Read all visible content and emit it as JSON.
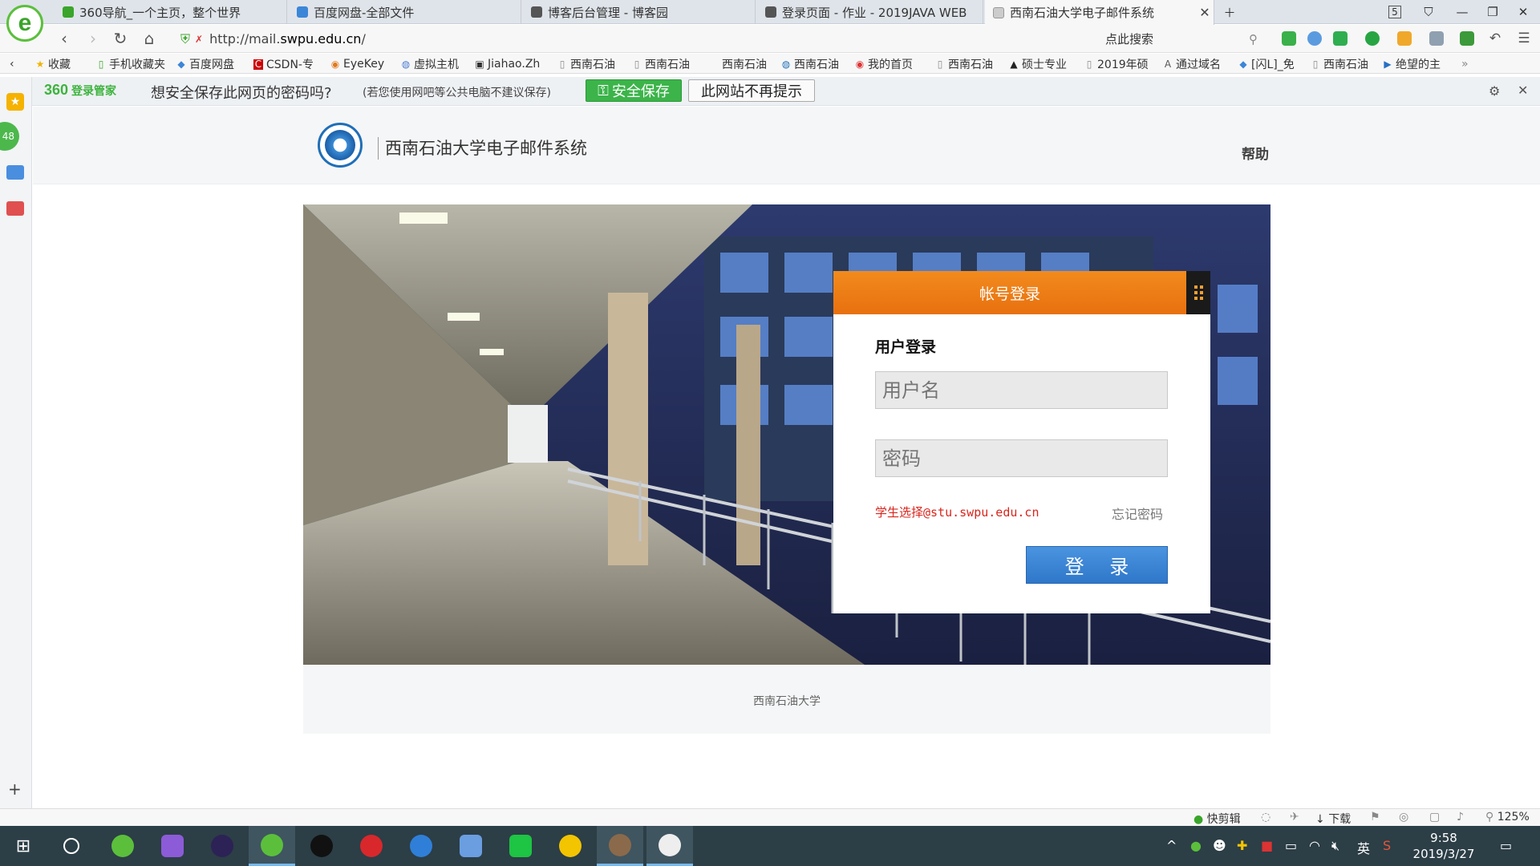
{
  "browser": {
    "tabs": [
      {
        "label": "360导航_一个主页，整个世界",
        "icon_color": "#3aa52a"
      },
      {
        "label": "百度网盘-全部文件",
        "icon_color": "#3b86d8"
      },
      {
        "label": "博客后台管理 - 博客园",
        "icon_color": "#555555"
      },
      {
        "label": "登录页面 - 作业 - 2019JAVA WEB",
        "icon_color": "#555555"
      },
      {
        "label": "西南石油大学电子邮件系统",
        "icon_color": "#999999",
        "active": true
      }
    ],
    "new_tab_icon": "plus-icon",
    "tab_count": "5",
    "url_prefix": "http://mail.",
    "url_domain": "swpu.edu.cn",
    "url_suffix": "/",
    "search_placeholder": "点此搜索",
    "bookmarks": [
      "收藏",
      "手机收藏夹",
      "百度网盘",
      "CSDN-专",
      "EyeKey",
      "虚拟主机",
      "Jiahao.Zh",
      "西南石油",
      "西南石油",
      "西南石油",
      "西南石油",
      "我的首页",
      "西南石油",
      "硕士专业",
      "2019年硕",
      "通过域名",
      "[闪L]_免",
      "西南石油",
      "绝望的主"
    ],
    "password_bar": {
      "brand": "360",
      "brand_sub": "登录管家",
      "question": "想安全保存此网页的密码吗?",
      "note": "(若您使用网吧等公共电脑不建议保存)",
      "save_label": "安全保存",
      "never_label": "此网站不再提示"
    },
    "sidebar_badge": "48"
  },
  "page": {
    "site_title": "西南石油大学电子邮件系统",
    "help": "帮助",
    "login": {
      "header": "帐号登录",
      "title": "用户登录",
      "username_placeholder": "用户名",
      "password_placeholder": "密码",
      "hint": "学生选择@stu.swpu.edu.cn",
      "forgot": "忘记密码",
      "submit": "登 录"
    },
    "footer": "西南石油大学"
  },
  "statusbar": {
    "clip": "快剪辑",
    "download": "下载",
    "zoom": "125%"
  },
  "taskbar": {
    "time": "9:58",
    "date": "2019/3/27",
    "ime": "英"
  }
}
